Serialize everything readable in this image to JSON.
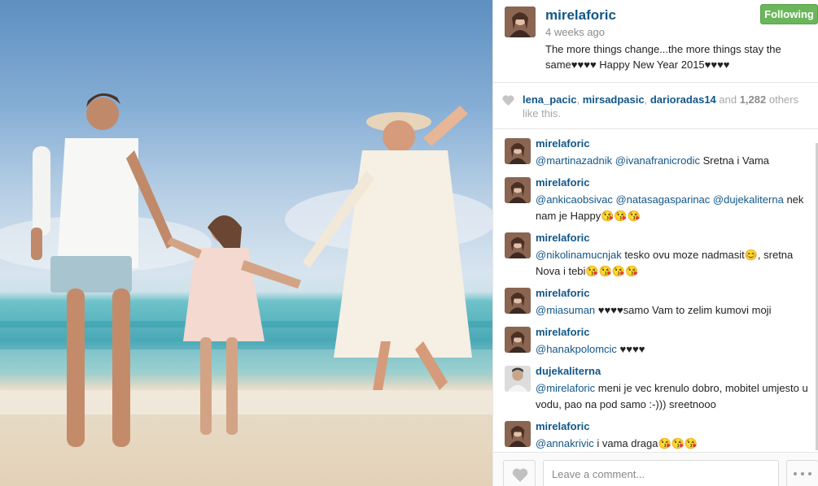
{
  "post": {
    "username": "mirelaforic",
    "time_ago": "4 weeks ago",
    "caption": "The more things change...the more things stay the same♥♥♥♥ Happy New Year 2015♥♥♥♥",
    "follow_label": "Following"
  },
  "likes": {
    "users": [
      "lena_pacic",
      "mirsadpasic",
      "darioradas14"
    ],
    "sep": ", ",
    "and": " and ",
    "count": "1,282",
    "suffix": " others like this."
  },
  "comments": [
    {
      "user": "mirelaforic",
      "mentions": "@martinazadnik @ivanafranicrodic",
      "text": " Sretna i Vama"
    },
    {
      "user": "mirelaforic",
      "mentions": "@ankicaobsivac @natasagasparinac @dujekaliterna",
      "text": " nek nam je Happy😘😘😘"
    },
    {
      "user": "mirelaforic",
      "mentions": "@nikolinamucnjak",
      "text": " tesko ovu moze nadmasit😊, sretna Nova i tebi😘😘😘😘"
    },
    {
      "user": "mirelaforic",
      "mentions": "@miasuman",
      "text": " ♥♥♥♥samo Vam to zelim kumovi moji"
    },
    {
      "user": "mirelaforic",
      "mentions": "@hanakpolomcic",
      "text": " ♥♥♥♥"
    },
    {
      "user": "dujekaliterna",
      "mentions": "@mirelaforic",
      "text": " meni je vec krenulo dobro, mobitel umjesto u vodu, pao na pod samo :-))) sreetnooo"
    },
    {
      "user": "mirelaforic",
      "mentions": "@annakrivic",
      "text": " i vama draga😘😘😘"
    }
  ],
  "footer": {
    "comment_placeholder": "Leave a comment..."
  },
  "icons": {
    "like_heart": "heart-icon",
    "more": "more-dots-icon"
  },
  "colors": {
    "link": "#125688",
    "follow_bg": "#6bb65a"
  }
}
